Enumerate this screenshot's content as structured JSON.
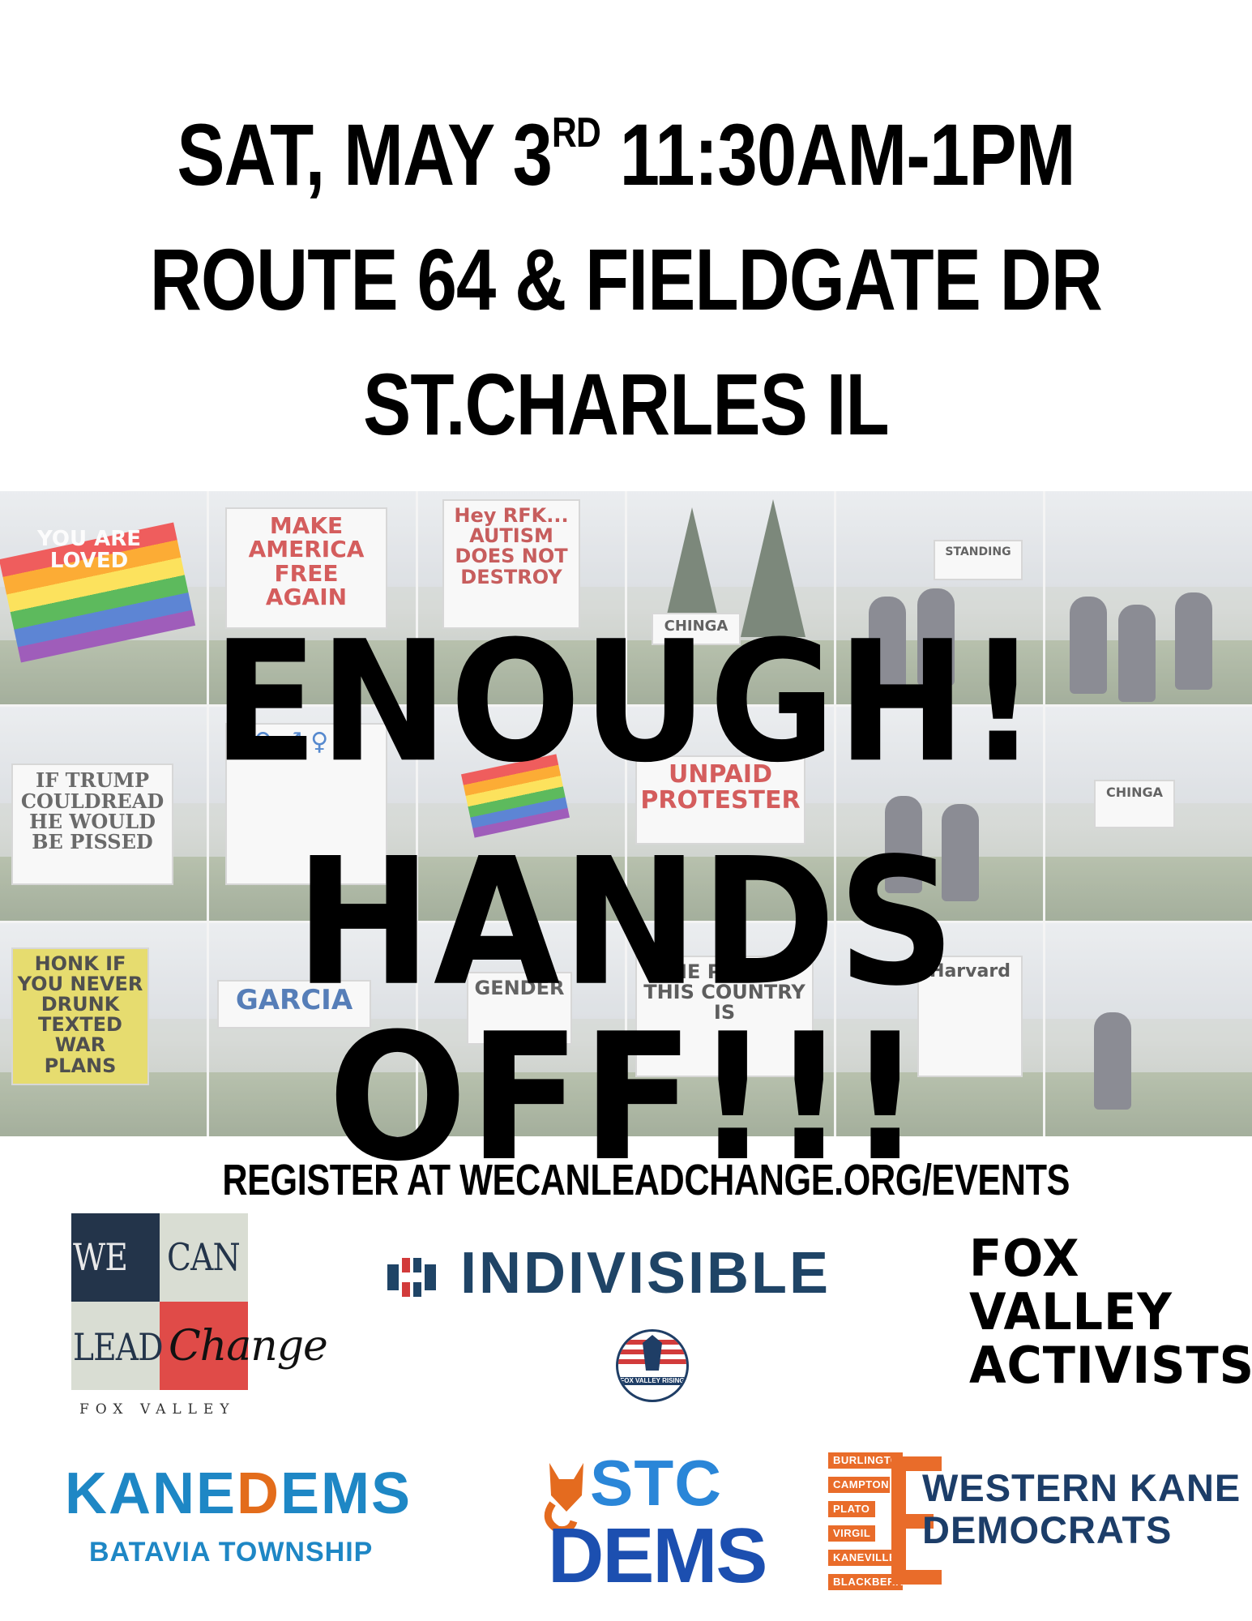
{
  "header": {
    "line1_main": "SAT, MAY 3",
    "line1_sup": "RD",
    "line1_time": " 11:30AM-1PM",
    "line2": "ROUTE 64 & FIELDGATE DR",
    "line3": "ST.CHARLES IL"
  },
  "collage_signs": [
    "YOU ARE LOVED",
    "MAKE AMERICA FREE AGAIN",
    "Hey RFK... AUTISM DOES NOT DESTROY",
    "CHINGA",
    "STANDING",
    "IF TRUMP COULDREAD HE WOULD BE PISSED",
    "UNPAID PROTESTER",
    "CHINGA",
    "HONK IF YOU NEVER DRUNK TEXTED WAR PLANS",
    "GARCIA",
    "GENDER",
    "THE PEOPLE THIS COUNTRY IS",
    "Harvard"
  ],
  "slogans": {
    "line1": "ENOUGH!",
    "line2": "HANDS OFF!!!"
  },
  "register": "REGISTER AT WECANLEADCHANGE.ORG/EVENTS",
  "logos": {
    "wcl": {
      "we": "WE",
      "can": "CAN",
      "lead": "LEAD",
      "change": "Change",
      "sub": "FOX VALLEY"
    },
    "indivisible": "INDIVISIBLE",
    "fox_valley_rising": "FOX VALLEY RISING",
    "fva": [
      "FOX",
      "VALLEY",
      "ACTIVISTS"
    ],
    "kane_dems": {
      "kane": "KANE",
      "d": "D",
      "ems": "EMS",
      "sub": "BATAVIA TOWNSHIP"
    },
    "stc_dems": {
      "stc": "STC",
      "dems": "DEMS"
    },
    "western_kane": {
      "line1": "WESTERN KANE",
      "line2": "DEMOCRATS",
      "tags": [
        "BURLINGTON",
        "CAMPTON",
        "PLATO",
        "VIRGIL",
        "KANEVILLE",
        "BLACKBERRY"
      ]
    }
  },
  "colors": {
    "kane_blue": "#1e87c5",
    "orange": "#e96c2a",
    "navy": "#1c3d68",
    "wcl_red": "#e04b48"
  }
}
